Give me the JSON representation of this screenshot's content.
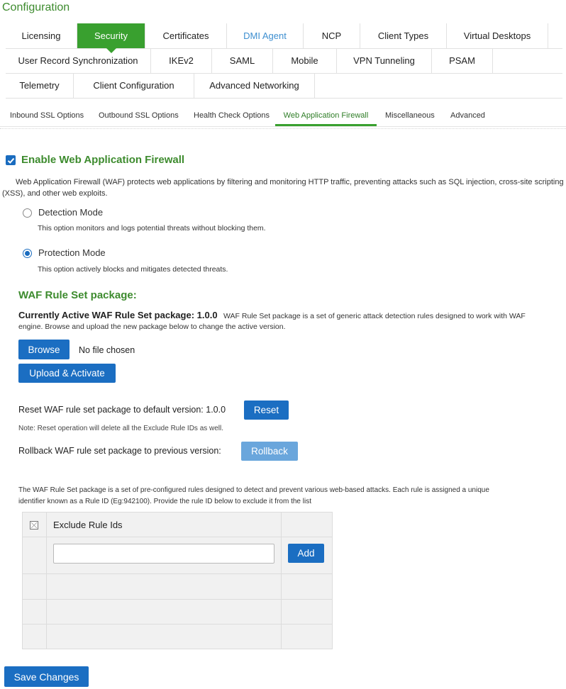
{
  "page": {
    "title": "Configuration"
  },
  "tabs": {
    "row1": [
      {
        "label": "Licensing"
      },
      {
        "label": "Security",
        "active": true
      },
      {
        "label": "Certificates"
      },
      {
        "label": "DMI Agent"
      },
      {
        "label": "NCP"
      },
      {
        "label": "Client Types"
      },
      {
        "label": "Virtual Desktops"
      }
    ],
    "row2": [
      {
        "label": "User Record Synchronization"
      },
      {
        "label": "IKEv2"
      },
      {
        "label": "SAML"
      },
      {
        "label": "Mobile"
      },
      {
        "label": "VPN Tunneling"
      },
      {
        "label": "PSAM"
      }
    ],
    "row3": [
      {
        "label": "Telemetry"
      },
      {
        "label": "Client Configuration"
      },
      {
        "label": "Advanced Networking"
      }
    ]
  },
  "subtabs": [
    {
      "label": "Inbound SSL Options"
    },
    {
      "label": "Outbound SSL Options"
    },
    {
      "label": "Health Check Options"
    },
    {
      "label": "Web Application Firewall",
      "active": true
    },
    {
      "label": "Miscellaneous"
    },
    {
      "label": "Advanced"
    }
  ],
  "waf": {
    "enable_label": "Enable Web Application Firewall",
    "enabled": true,
    "description_line1": "Web Application Firewall (WAF) protects web applications by filtering and monitoring HTTP traffic, preventing attacks such as SQL injection, cross-site scripting",
    "description_line2": "(XSS), and other web exploits.",
    "detection_label": "Detection Mode",
    "detection_desc": "This option monitors and logs potential threats without blocking them.",
    "protection_label": "Protection Mode",
    "protection_desc": "This option actively blocks and mitigates detected threats.",
    "selected_mode": "Protection Mode"
  },
  "ruleset": {
    "heading": "WAF Rule Set package:",
    "active_label": "Currently Active WAF Rule Set package: 1.0.0",
    "active_desc_line1": "WAF Rule Set package is a set of generic attack detection rules designed to work with WAF",
    "active_desc_line2": "engine. Browse and upload the new package below to change the active version.",
    "browse_label": "Browse",
    "no_file": "No file chosen",
    "upload_label": "Upload & Activate",
    "reset_text": "Reset WAF rule set package to default version: 1.0.0",
    "reset_label": "Reset",
    "reset_note": "Note: Reset operation will delete all the Exclude Rule IDs as well.",
    "rollback_text": "Rollback WAF rule set package to previous version:",
    "rollback_label": "Rollback"
  },
  "exclude": {
    "desc_line1": "The WAF Rule Set package is a set of pre-configured rules designed to detect and prevent various web-based attacks. Each rule is assigned a unique",
    "desc_line2": "identifier known as a Rule ID (Eg:942100). Provide the rule ID below to exclude it from the list",
    "column_header": "Exclude Rule Ids",
    "input_value": "",
    "add_label": "Add"
  },
  "footer": {
    "save_label": "Save Changes"
  },
  "colors": {
    "accent_green": "#39a02f",
    "title_green": "#3d8b2e",
    "button_blue": "#1b6ec2",
    "link_blue": "#3e8fd0"
  }
}
